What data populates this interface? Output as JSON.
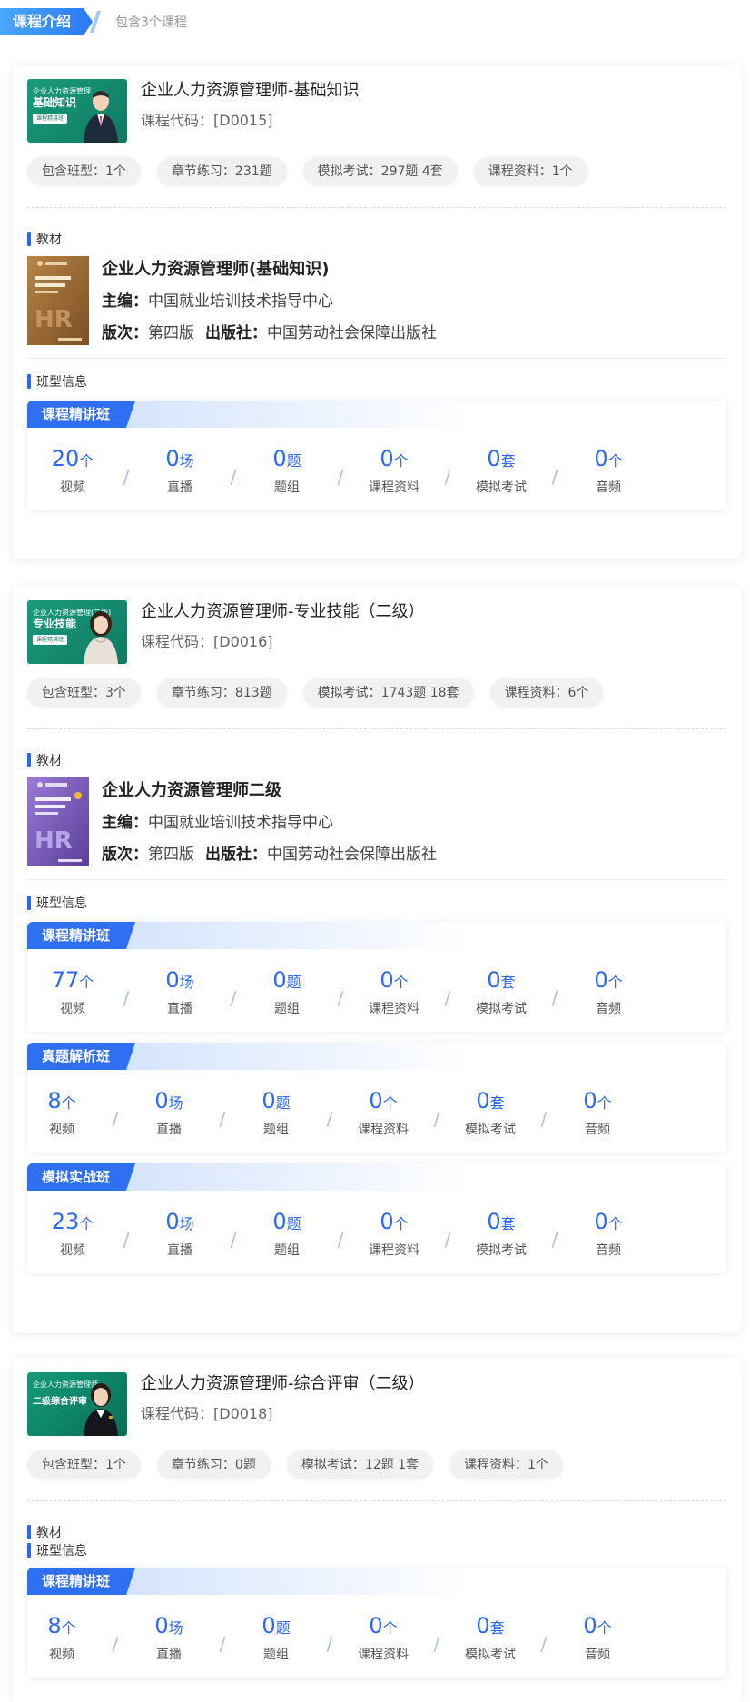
{
  "header": {
    "badge": "课程介绍",
    "subtitle": "包含3个课程"
  },
  "labels": {
    "textbook": "教材",
    "class_info": "班型信息",
    "editor": "主编：",
    "edition": "版次：",
    "publisher": "出版社："
  },
  "stat_labels": [
    "视频",
    "直播",
    "题组",
    "课程资料",
    "模拟考试",
    "音频"
  ],
  "stat_units": [
    "个",
    "场",
    "题",
    "个",
    "套",
    "个"
  ],
  "courses": [
    {
      "title": "企业人力资源管理师-基础知识",
      "code": "课程代码：[D0015]",
      "thumb": {
        "line1": "企业人力资源管理",
        "title": "基础知识",
        "tag": "课程精讲班",
        "color": "#1a9a7c"
      },
      "tags": [
        "包含班型：1个",
        "章节练习：231题",
        "模拟考试：297题 4套",
        "课程资料：1个"
      ],
      "book": {
        "title": "企业人力资源管理师(基础知识)",
        "editor": "中国就业培训技术指导中心",
        "edition": "第四版",
        "publisher": "中国劳动社会保障出版社",
        "cover_color": "#9a6a34"
      },
      "classes": [
        {
          "name": "课程精讲班",
          "values": [
            "20",
            "0",
            "0",
            "0",
            "0",
            "0"
          ]
        }
      ]
    },
    {
      "title": "企业人力资源管理师-专业技能（二级）",
      "code": "课程代码：[D0016]",
      "thumb": {
        "line1": "企业人力资源管理(二级)",
        "title": "专业技能",
        "tag": "课程精讲班",
        "color": "#1a9a7c"
      },
      "tags": [
        "包含班型：3个",
        "章节练习：813题",
        "模拟考试：1743题 18套",
        "课程资料：6个"
      ],
      "book": {
        "title": "企业人力资源管理师二级",
        "editor": "中国就业培训技术指导中心",
        "edition": "第四版",
        "publisher": "中国劳动社会保障出版社",
        "cover_color": "#7a5ab8"
      },
      "classes": [
        {
          "name": "课程精讲班",
          "values": [
            "77",
            "0",
            "0",
            "0",
            "0",
            "0"
          ]
        },
        {
          "name": "真题解析班",
          "values": [
            "8",
            "0",
            "0",
            "0",
            "0",
            "0"
          ]
        },
        {
          "name": "模拟实战班",
          "values": [
            "23",
            "0",
            "0",
            "0",
            "0",
            "0"
          ]
        }
      ]
    },
    {
      "title": "企业人力资源管理师-综合评审（二级）",
      "code": "课程代码：[D0018]",
      "thumb": {
        "line1": "企业人力资源管理师",
        "title": "二级综合评审",
        "tag": "",
        "color": "#0f8a6e"
      },
      "tags": [
        "包含班型：1个",
        "章节练习：0题",
        "模拟考试：12题 1套",
        "课程资料：1个"
      ],
      "classes": [
        {
          "name": "课程精讲班",
          "values": [
            "8",
            "0",
            "0",
            "0",
            "0",
            "0"
          ]
        }
      ]
    }
  ]
}
